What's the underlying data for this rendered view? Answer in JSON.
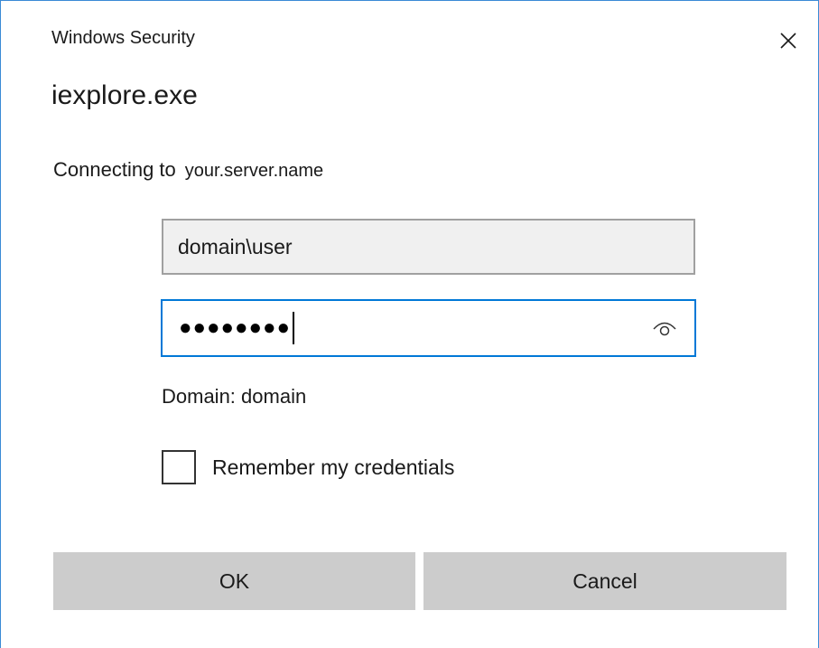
{
  "window": {
    "title": "Windows Security",
    "close_icon": "close-icon"
  },
  "app": {
    "name": "iexplore.exe"
  },
  "connection": {
    "prefix": "Connecting to",
    "server": "your.server.name"
  },
  "fields": {
    "username_value": "domain\\user",
    "password_masked": "●●●●●●●●",
    "reveal_icon": "eye-icon"
  },
  "domain_info": "Domain: domain",
  "remember": {
    "label": "Remember my credentials",
    "checked": false
  },
  "buttons": {
    "ok": "OK",
    "cancel": "Cancel"
  },
  "colors": {
    "focus_border": "#0078d7",
    "window_border": "#3a8ad6",
    "button_bg": "#cccccc",
    "field_bg": "#f0f0f0"
  }
}
